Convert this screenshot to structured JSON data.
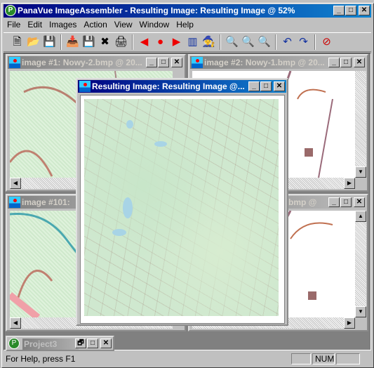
{
  "app": {
    "title": "PanaVue ImageAssembler - Resulting Image: Resulting Image  @ 52%",
    "icon": "panavue-logo-icon"
  },
  "menu": [
    "File",
    "Edit",
    "Images",
    "Action",
    "View",
    "Window",
    "Help"
  ],
  "toolbar": [
    {
      "name": "new-icon",
      "glyph": "🗎"
    },
    {
      "name": "open-folder-icon",
      "glyph": "📂"
    },
    {
      "name": "save-icon",
      "glyph": "💾"
    },
    "sep",
    {
      "name": "add-image-icon",
      "glyph": "📥"
    },
    {
      "name": "save-image-icon",
      "glyph": "💾"
    },
    {
      "name": "remove-image-icon",
      "glyph": "✖"
    },
    {
      "name": "scan-icon",
      "glyph": "🖨"
    },
    "sep",
    {
      "name": "previous-icon",
      "glyph": "◀"
    },
    {
      "name": "record-icon",
      "glyph": "●"
    },
    {
      "name": "next-icon",
      "glyph": "▶"
    },
    {
      "name": "columns-icon",
      "glyph": "▥"
    },
    {
      "name": "wizard-icon",
      "glyph": "🧙"
    },
    "sep",
    {
      "name": "zoom-in-icon",
      "glyph": "🔍"
    },
    {
      "name": "zoom-out-icon",
      "glyph": "🔍"
    },
    {
      "name": "zoom-fit-icon",
      "glyph": "🔍"
    },
    "sep",
    {
      "name": "undo-icon",
      "glyph": "↶"
    },
    {
      "name": "redo-icon",
      "glyph": "↷"
    },
    "sep",
    {
      "name": "stop-assembly-icon",
      "glyph": "⊘"
    }
  ],
  "windows": {
    "image1": "image #1: Nowy-2.bmp @ 20...",
    "image2": "image #2: Nowy-1.bmp @ 20...",
    "image101": "image #101: ",
    "image_br": "bmp @",
    "result": "Resulting Image: Resulting Image  @...",
    "project": "Project3"
  },
  "status": {
    "help": "For Help, press F1",
    "num": "NUM"
  }
}
